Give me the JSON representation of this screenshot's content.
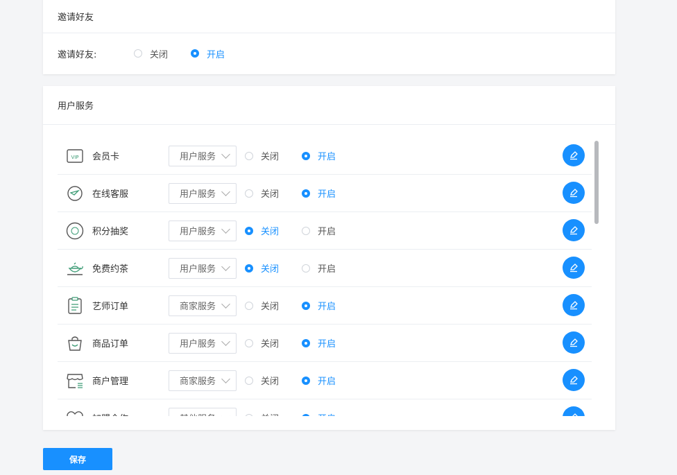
{
  "invite": {
    "section_title": "邀请好友",
    "label": "邀请好友:",
    "options": [
      {
        "label": "关闭",
        "selected": false
      },
      {
        "label": "开启",
        "selected": true
      }
    ]
  },
  "services": {
    "section_title": "用户服务",
    "items": [
      {
        "icon": "vip-card-icon",
        "name": "会员卡",
        "category": "用户服务",
        "off_label": "关闭",
        "on_label": "开启",
        "enabled": true
      },
      {
        "icon": "chat-bubble-icon",
        "name": "在线客服",
        "category": "用户服务",
        "off_label": "关闭",
        "on_label": "开启",
        "enabled": true
      },
      {
        "icon": "lottery-icon",
        "name": "积分抽奖",
        "category": "用户服务",
        "off_label": "关闭",
        "on_label": "开启",
        "enabled": false
      },
      {
        "icon": "teapot-icon",
        "name": "免费约茶",
        "category": "用户服务",
        "off_label": "关闭",
        "on_label": "开启",
        "enabled": false
      },
      {
        "icon": "clipboard-icon",
        "name": "艺师订单",
        "category": "商家服务",
        "off_label": "关闭",
        "on_label": "开启",
        "enabled": true
      },
      {
        "icon": "shopping-bag-icon",
        "name": "商品订单",
        "category": "用户服务",
        "off_label": "关闭",
        "on_label": "开启",
        "enabled": true
      },
      {
        "icon": "store-icon",
        "name": "商户管理",
        "category": "商家服务",
        "off_label": "关闭",
        "on_label": "开启",
        "enabled": true
      },
      {
        "icon": "handshake-heart-icon",
        "name": "加盟合作",
        "category": "其他服务",
        "off_label": "关闭",
        "on_label": "开启",
        "enabled": true
      }
    ]
  },
  "save_label": "保存",
  "colors": {
    "accent": "#1890ff",
    "background": "#f4f5f7",
    "icon_green": "#3e9c76"
  }
}
